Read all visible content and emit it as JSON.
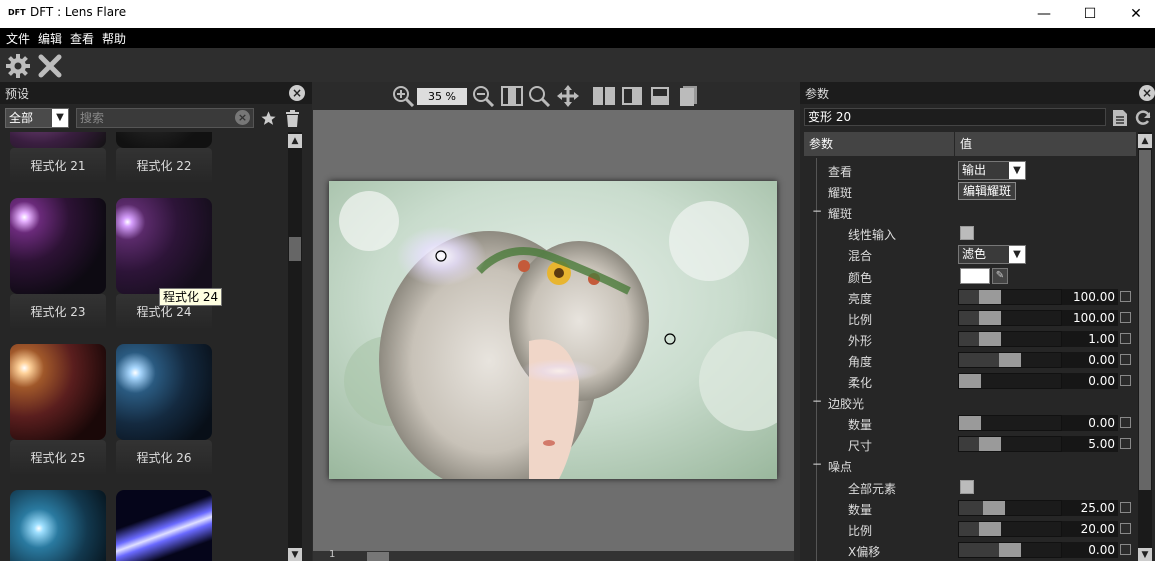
{
  "window": {
    "logo": "DFT",
    "title": "DFT : Lens Flare",
    "minimize": "—",
    "maximize": "☐",
    "close": "✕"
  },
  "menu": [
    "文件",
    "编辑",
    "查看",
    "帮助"
  ],
  "toolbar": {
    "icons": [
      "gear-icon",
      "close-x-icon"
    ]
  },
  "presets_panel": {
    "title": "预设",
    "filter_value": "全部",
    "search_placeholder": "搜索",
    "items": [
      {
        "label": "程式化 21"
      },
      {
        "label": "程式化 22"
      },
      {
        "label": "程式化 23"
      },
      {
        "label": "程式化 24"
      },
      {
        "label": "程式化 25"
      },
      {
        "label": "程式化 26"
      }
    ],
    "tooltip": "程式化 24"
  },
  "canvas": {
    "zoom": "35 %",
    "page": "1"
  },
  "params_panel": {
    "title": "参数",
    "preset_name": "变形 20",
    "col_param": "参数",
    "col_value": "值",
    "rows": [
      {
        "label": "查看",
        "type": "dropdown",
        "value": "输出"
      },
      {
        "label": "耀斑",
        "type": "button",
        "value": "编辑耀斑"
      },
      {
        "label": "耀斑",
        "type": "group"
      },
      {
        "label": "线性输入",
        "type": "checkbox"
      },
      {
        "label": "混合",
        "type": "dropdown",
        "value": "滤色"
      },
      {
        "label": "颜色",
        "type": "color",
        "value": "#ffffff"
      },
      {
        "label": "亮度",
        "type": "slider",
        "value": "100.00",
        "level": 0.25
      },
      {
        "label": "比例",
        "type": "slider",
        "value": "100.00",
        "level": 0.25
      },
      {
        "label": "外形",
        "type": "slider",
        "value": "1.00",
        "level": 0.25
      },
      {
        "label": "角度",
        "type": "slider",
        "value": "0.00",
        "level": 0.5
      },
      {
        "label": "柔化",
        "type": "slider",
        "value": "0.00",
        "level": 0.0
      },
      {
        "label": "边胶光",
        "type": "group"
      },
      {
        "label": "数量",
        "type": "slider",
        "value": "0.00",
        "level": 0.0
      },
      {
        "label": "尺寸",
        "type": "slider",
        "value": "5.00",
        "level": 0.25
      },
      {
        "label": "噪点",
        "type": "group"
      },
      {
        "label": "全部元素",
        "type": "checkbox"
      },
      {
        "label": "数量",
        "type": "slider",
        "value": "25.00",
        "level": 0.3
      },
      {
        "label": "比例",
        "type": "slider",
        "value": "20.00",
        "level": 0.25
      },
      {
        "label": "X偏移",
        "type": "slider",
        "value": "0.00",
        "level": 0.5
      }
    ]
  }
}
